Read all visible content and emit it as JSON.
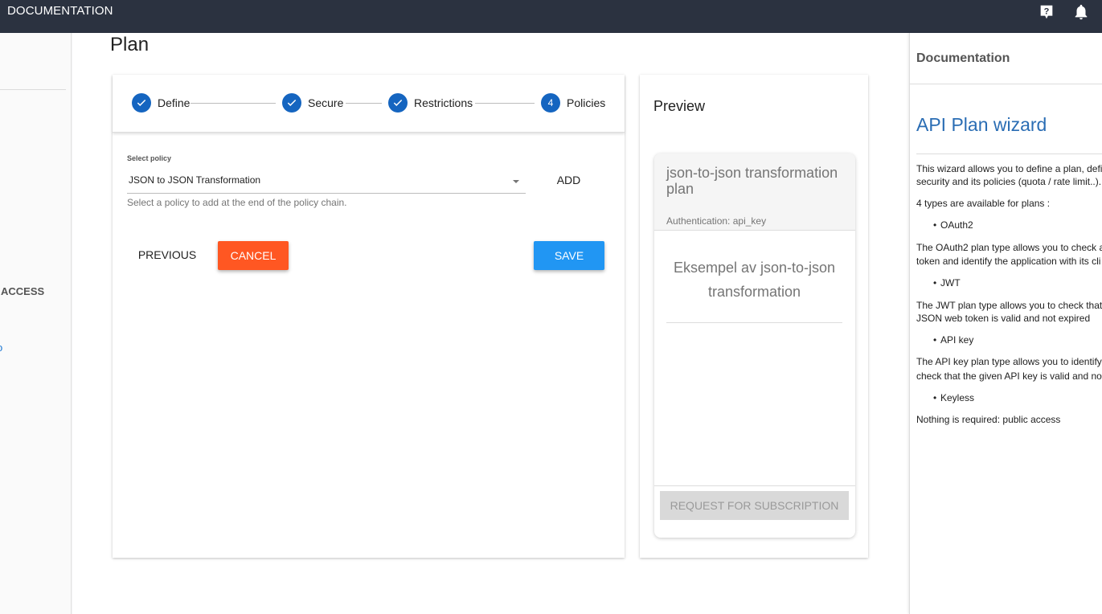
{
  "topbar": {
    "title": "DOCUMENTATION"
  },
  "leftnav": {
    "access_label": "ACCESS",
    "link_fragment": "o"
  },
  "page": {
    "title": "Plan"
  },
  "stepper": {
    "steps": [
      {
        "label": "Define",
        "state": "done"
      },
      {
        "label": "Secure",
        "state": "done"
      },
      {
        "label": "Restrictions",
        "state": "done"
      },
      {
        "label": "Policies",
        "state": "active",
        "number": "4"
      }
    ]
  },
  "policy": {
    "select_label": "Select policy",
    "selected_value": "JSON to JSON Transformation",
    "hint": "Select a policy to add at the end of the policy chain.",
    "add_label": "ADD"
  },
  "actions": {
    "previous_label": "PREVIOUS",
    "cancel_label": "CANCEL",
    "save_label": "SAVE"
  },
  "preview": {
    "title": "Preview",
    "plan_name": "json-to-json transformation plan",
    "authentication": "Authentication: api_key",
    "description": "Eksempel av json-to-json transformation",
    "subscribe_label": "REQUEST FOR SUBSCRIPTION"
  },
  "documentation": {
    "header": "Documentation",
    "title": "API Plan wizard",
    "intro_1": "This wizard allows you to define a plan, defi",
    "intro_2": "security and its policies (quota / rate limit..).",
    "types_intro": "4 types are available for plans :",
    "oauth2": "OAuth2",
    "oauth2_desc_1": "The OAuth2 plan type allows you to check a",
    "oauth2_desc_2": "token and identify the application with its cli",
    "jwt": "JWT",
    "jwt_desc_1": "The JWT plan type allows you to check that",
    "jwt_desc_2": "JSON web token is valid and not expired",
    "apikey": "API key",
    "apikey_desc_1": "The API key plan type allows you to identify",
    "apikey_desc_2": "check that the given API key is valid and no",
    "keyless": "Keyless",
    "keyless_desc": "Nothing is required: public access"
  },
  "colors": {
    "topbar": "#2b3240",
    "step": "#1565c0",
    "cancel": "#ff5722",
    "save": "#2196f3",
    "doc_title": "#2a6db4"
  },
  "icons": {
    "help": "help-icon",
    "bell": "bell-icon",
    "check": "check-icon",
    "caret": "caret-down-icon"
  }
}
